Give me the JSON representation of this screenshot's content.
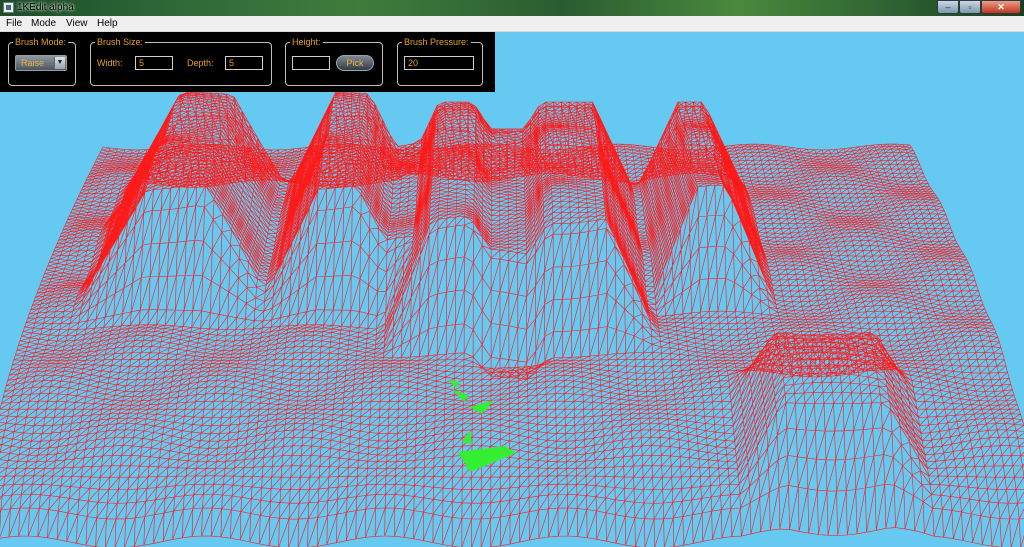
{
  "window": {
    "title": "1KEdit alpha",
    "controls": {
      "minimize": "–",
      "maximize": "▫",
      "close": "✕"
    }
  },
  "menu": {
    "items": [
      "File",
      "Mode",
      "View",
      "Help"
    ]
  },
  "toolbar": {
    "brush_mode": {
      "label": "Brush Mode:",
      "value": "Raise"
    },
    "brush_size": {
      "label": "Brush Size:",
      "width_label": "Width:",
      "width_value": "5",
      "depth_label": "Depth:",
      "depth_value": "5"
    },
    "height": {
      "label": "Height:",
      "value": "",
      "pick_label": "Pick"
    },
    "brush_pressure": {
      "label": "Brush Pressure:",
      "value": "20"
    }
  },
  "colors": {
    "sky": "#66c9f2",
    "wireframe": "#ff1a1a",
    "selection": "#33ee33",
    "toolbar_bg": "#000000",
    "toolbar_text": "#e7a11a"
  },
  "icons": {
    "app": "app-window-icon",
    "dropdown": "chevron-down-icon"
  }
}
